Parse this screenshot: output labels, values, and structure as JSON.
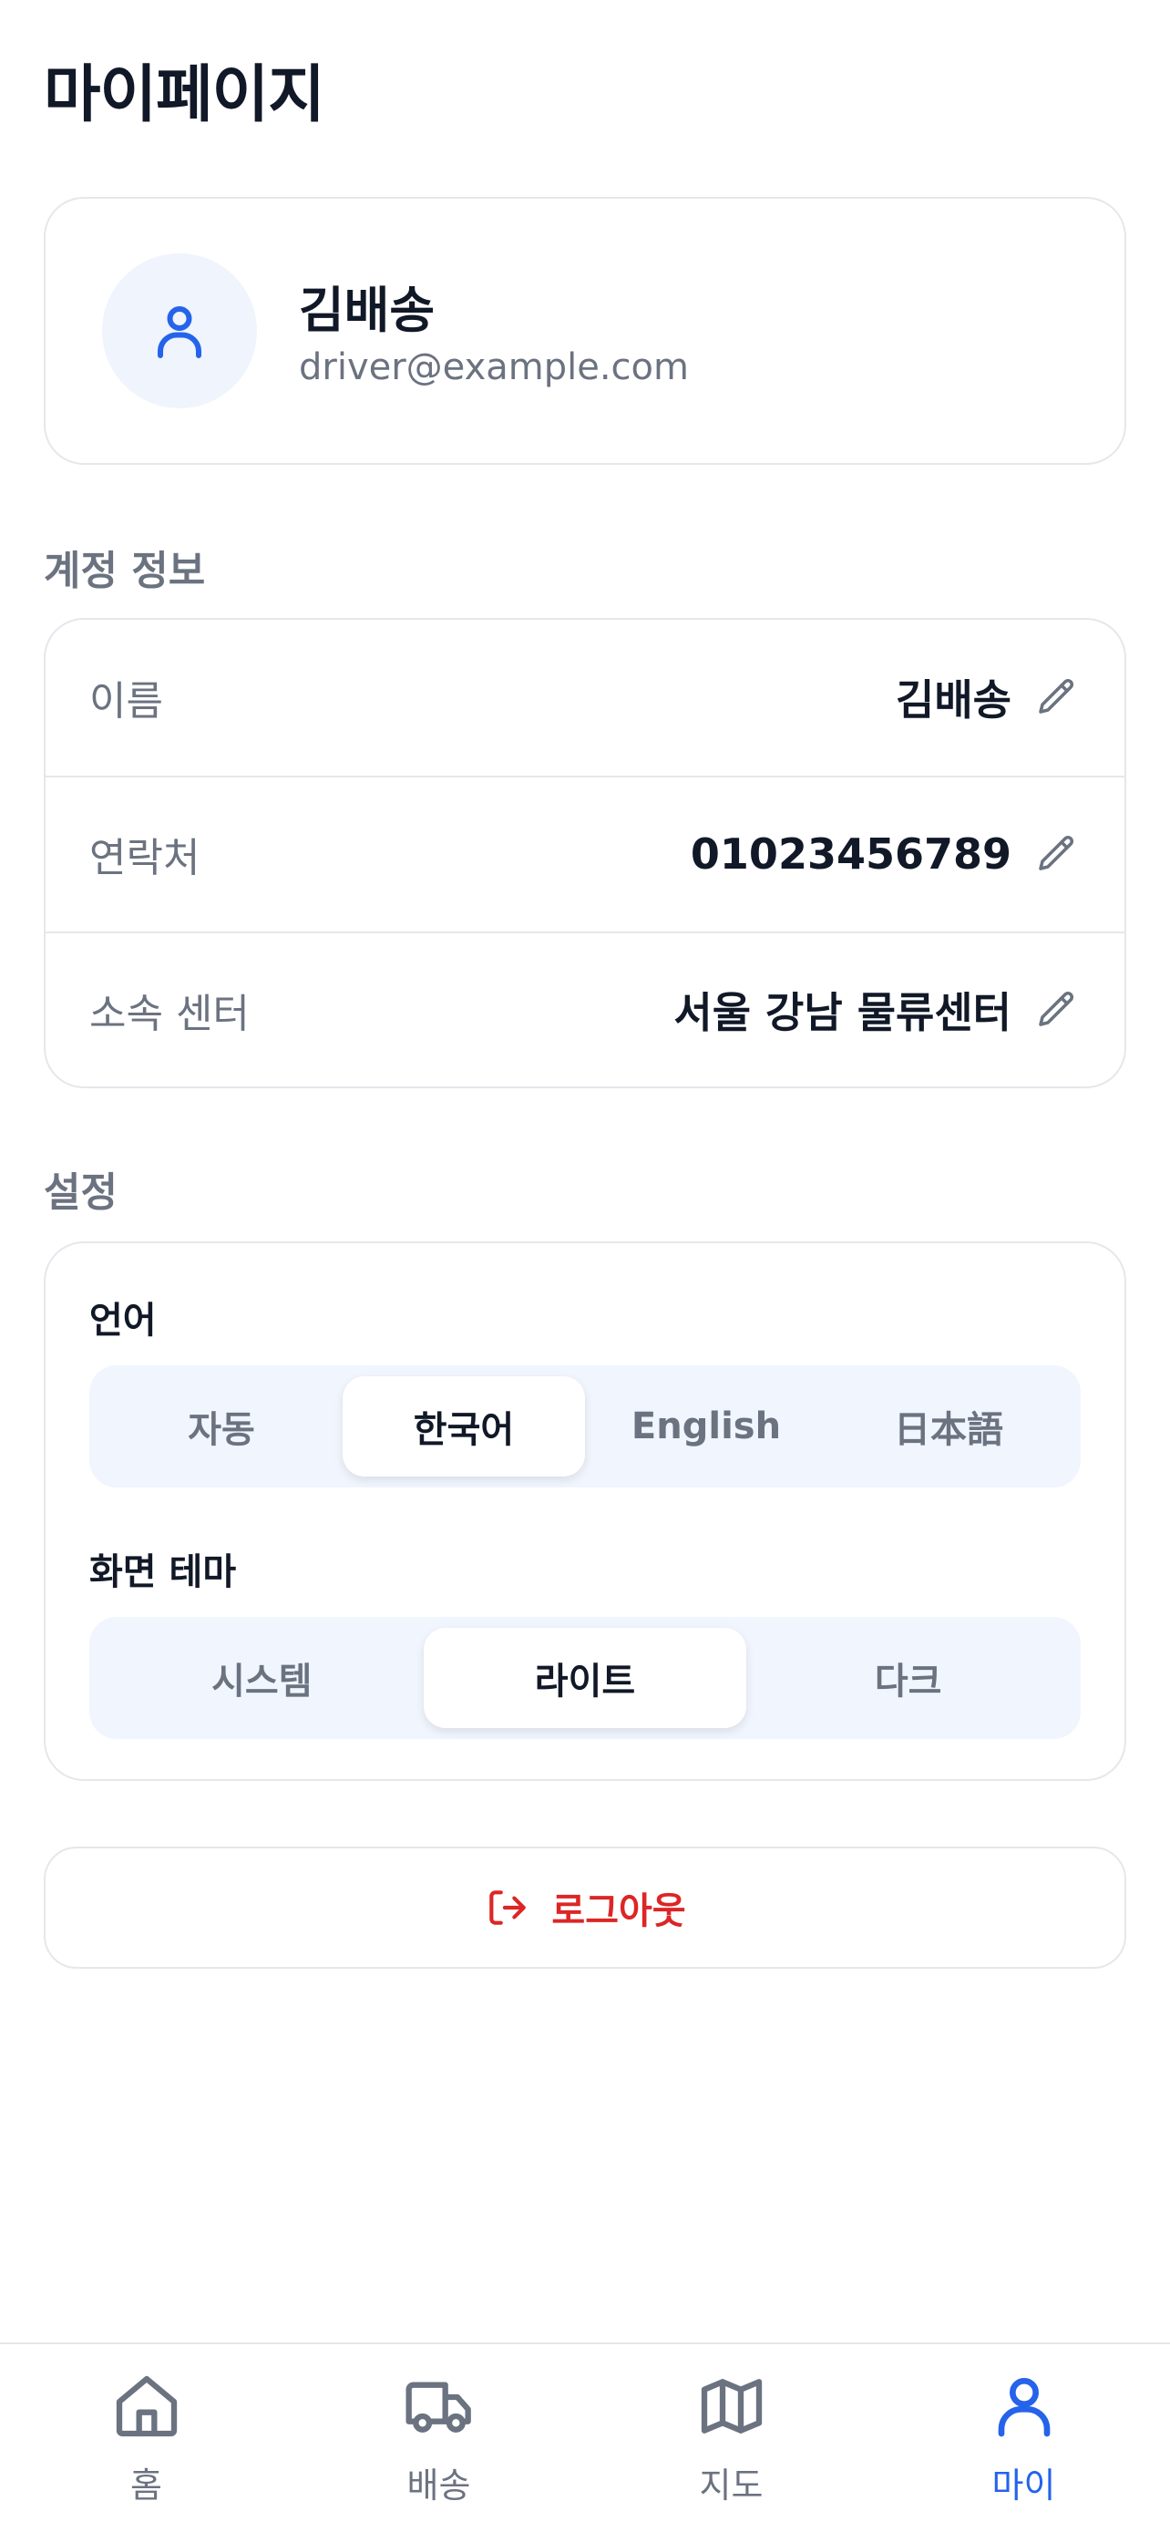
{
  "page": {
    "title": "마이페이지"
  },
  "profile": {
    "name": "김배송",
    "email": "driver@example.com",
    "avatar_icon": "user-icon"
  },
  "account": {
    "section_label": "계정 정보",
    "rows": [
      {
        "label": "이름",
        "value": "김배송"
      },
      {
        "label": "연락처",
        "value": "01023456789"
      },
      {
        "label": "소속 센터",
        "value": "서울 강남 물류센터"
      }
    ],
    "edit_icon": "pencil-icon"
  },
  "settings": {
    "section_label": "설정",
    "language": {
      "title": "언어",
      "options": [
        "자동",
        "한국어",
        "English",
        "日本語"
      ],
      "selected": "한국어"
    },
    "theme": {
      "title": "화면 테마",
      "options": [
        "시스템",
        "라이트",
        "다크"
      ],
      "selected": "라이트"
    }
  },
  "logout": {
    "label": "로그아웃",
    "icon": "logout-icon"
  },
  "nav": {
    "items": [
      {
        "label": "홈",
        "icon": "home-icon"
      },
      {
        "label": "배송",
        "icon": "truck-icon"
      },
      {
        "label": "지도",
        "icon": "map-icon"
      },
      {
        "label": "마이",
        "icon": "user-icon"
      }
    ],
    "active": "마이"
  },
  "colors": {
    "accent": "#2563eb",
    "danger": "#dc2626",
    "muted": "#6b7280",
    "text": "#111827",
    "border": "#e5e7eb",
    "segment_bg": "#f1f5fd"
  }
}
